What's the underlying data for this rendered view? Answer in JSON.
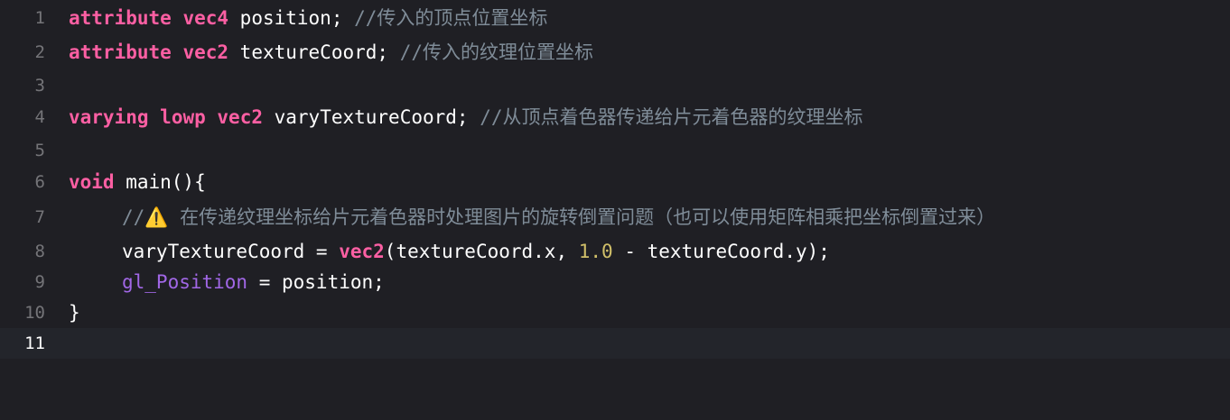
{
  "editor": {
    "lines": [
      {
        "number": "1",
        "kw1": "attribute",
        "sp1": " ",
        "kw2": "vec4",
        "plain": " position; ",
        "comment": "//传入的顶点位置坐标"
      },
      {
        "number": "2",
        "kw1": "attribute",
        "sp1": " ",
        "kw2": "vec2",
        "plain": " textureCoord; ",
        "comment": "//传入的纹理位置坐标"
      },
      {
        "number": "3"
      },
      {
        "number": "4",
        "kw1": "varying",
        "sp1": " ",
        "kw2": "lowp",
        "sp2": " ",
        "kw3": "vec2",
        "plain": " varyTextureCoord; ",
        "comment": "//从顶点着色器传递给片元着色器的纹理坐标"
      },
      {
        "number": "5"
      },
      {
        "number": "6",
        "kw1": "void",
        "plain": " main(){"
      },
      {
        "number": "7",
        "comment_prefix": "//",
        "warning_icon": "⚠️",
        "comment": " 在传递纹理坐标给片元着色器时处理图片的旋转倒置问题（也可以使用矩阵相乘把坐标倒置过来）"
      },
      {
        "number": "8",
        "plain1": "varyTextureCoord = ",
        "kw1": "vec2",
        "plain2": "(textureCoord.x, ",
        "num": "1.0",
        "plain3": " - textureCoord.y);"
      },
      {
        "number": "9",
        "builtin": "gl_Position",
        "plain": " = position;"
      },
      {
        "number": "10",
        "plain": "}"
      },
      {
        "number": "11"
      }
    ]
  },
  "colors": {
    "background": "#1f1f24",
    "current_line": "#23252b",
    "keyword": "#fc5fa3",
    "comment": "#7f8c98",
    "number": "#d0bf69",
    "builtin": "#a167e6",
    "line_number": "#747478"
  }
}
